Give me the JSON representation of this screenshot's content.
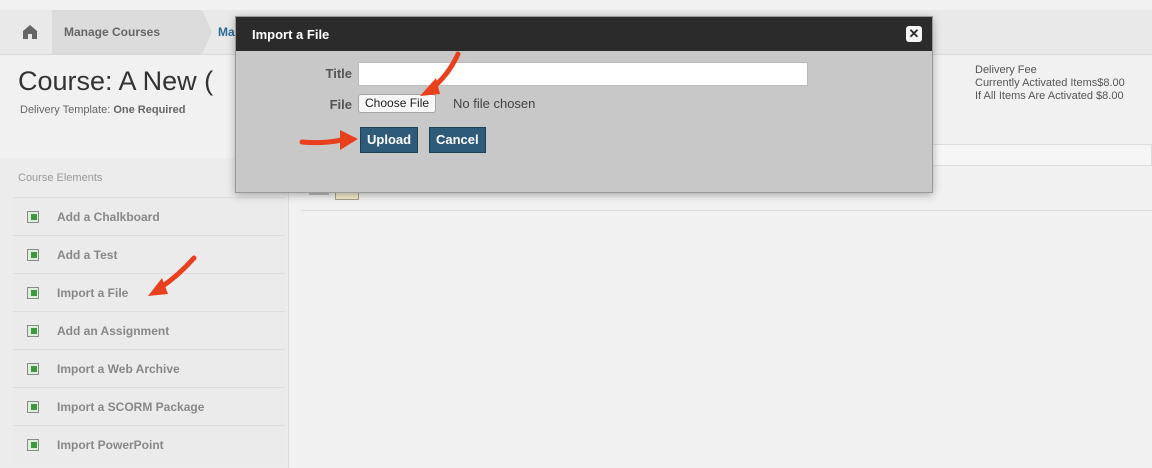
{
  "breadcrumb": {
    "home_icon": "home-icon",
    "items": [
      "Manage Courses",
      "Ma"
    ]
  },
  "course": {
    "title": "Course: A New (",
    "delivery_template_label": "Delivery Template:",
    "delivery_template_value": "One Required",
    "fees": {
      "delivery_fee": "Delivery Fee",
      "currently_activated": "Currently Activated Items$8.00",
      "all_activated": "If All Items Are Activated $8.00"
    }
  },
  "sidebar": {
    "heading": "Course Elements",
    "items": [
      {
        "label": "Add a Chalkboard",
        "icon": "add-chalkboard-icon"
      },
      {
        "label": "Add a Test",
        "icon": "add-test-icon"
      },
      {
        "label": "Import a File",
        "icon": "import-file-icon"
      },
      {
        "label": "Add an Assignment",
        "icon": "add-assignment-icon"
      },
      {
        "label": "Import a Web Archive",
        "icon": "import-web-archive-icon"
      },
      {
        "label": "Import a SCORM Package",
        "icon": "import-scorm-icon"
      },
      {
        "label": "Import PowerPoint",
        "icon": "import-powerpoint-icon"
      }
    ]
  },
  "modal": {
    "title": "Import a File",
    "close_icon": "close-icon",
    "title_label": "Title",
    "title_value": "",
    "file_label": "File",
    "choose_file_label": "Choose File",
    "no_file_text": "No file chosen",
    "upload_label": "Upload",
    "cancel_label": "Cancel"
  },
  "annotations": {
    "arrow_color": "#e8401c"
  },
  "colors": {
    "modal_header": "#2b2b2b",
    "button_bg": "#2f5b7a",
    "breadcrumb_link": "#2a6a94"
  }
}
